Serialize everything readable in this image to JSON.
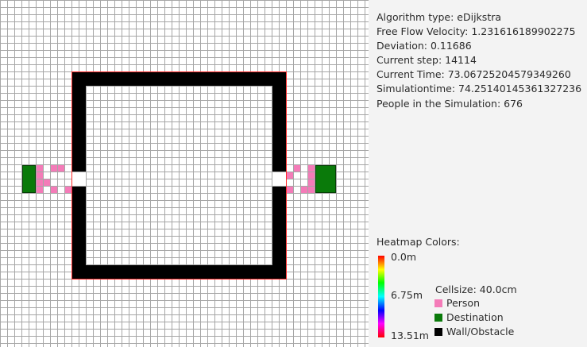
{
  "info": {
    "algorithm": "Algorithm type: eDijkstra",
    "free_flow_velocity": "Free Flow Velocity: 1.231616189902275",
    "deviation": "Deviation: 0.11686",
    "current_step": "Current step: 14114",
    "current_time": "Current Time: 73.06725204579349260",
    "simulation_time": "Simulationtime: 74.25140145361327236",
    "people": "People in the Simulation: 676"
  },
  "legend": {
    "title": "Heatmap Colors:",
    "tick_top": "0.0m",
    "tick_mid": "6.75m",
    "tick_bottom": "13.51m",
    "cellsize": "Cellsize: 40.0cm",
    "person_label": "Person",
    "destination_label": "Destination",
    "wall_label": "Wall/Obstacle"
  },
  "colors": {
    "person": "#f47bb8",
    "destination": "#0a7a0a",
    "wall": "#000000",
    "heatmap": [
      "#ff0000",
      "#ffff00",
      "#00ff00",
      "#00ffff",
      "#0000ff",
      "#ff00ff",
      "#ff0000"
    ]
  }
}
